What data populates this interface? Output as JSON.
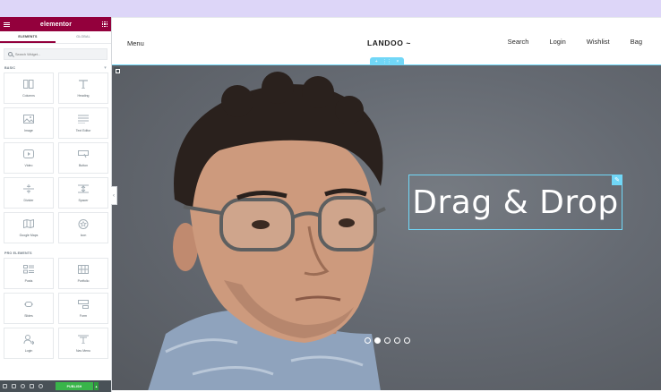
{
  "panel": {
    "brand": "elementor",
    "tabs": [
      {
        "label": "ELEMENTS",
        "active": true
      },
      {
        "label": "GLOBAL",
        "active": false
      }
    ],
    "search_placeholder": "Search Widget...",
    "categories": [
      {
        "title": "BASIC",
        "widgets": [
          {
            "label": "Columns",
            "icon": "columns-icon"
          },
          {
            "label": "Heading",
            "icon": "heading-icon"
          },
          {
            "label": "Image",
            "icon": "image-icon"
          },
          {
            "label": "Text Editor",
            "icon": "text-editor-icon"
          },
          {
            "label": "Video",
            "icon": "video-icon"
          },
          {
            "label": "Button",
            "icon": "button-icon"
          },
          {
            "label": "Divider",
            "icon": "divider-icon"
          },
          {
            "label": "Spacer",
            "icon": "spacer-icon"
          },
          {
            "label": "Google Maps",
            "icon": "map-icon"
          },
          {
            "label": "Icon",
            "icon": "star-icon"
          }
        ]
      },
      {
        "title": "PRO ELEMENTS",
        "widgets": [
          {
            "label": "Posts",
            "icon": "posts-icon"
          },
          {
            "label": "Portfolio",
            "icon": "portfolio-icon"
          },
          {
            "label": "Slides",
            "icon": "slides-icon"
          },
          {
            "label": "Form",
            "icon": "form-icon"
          },
          {
            "label": "Login",
            "icon": "login-icon"
          },
          {
            "label": "Nav Menu",
            "icon": "nav-menu-icon"
          }
        ]
      }
    ],
    "footer": {
      "publish_label": "PUBLISH"
    }
  },
  "site": {
    "nav_left": "Menu",
    "logo": "LANDOO ~",
    "nav_right": [
      "Search",
      "Login",
      "Wishlist",
      "Bag"
    ]
  },
  "hero": {
    "headline": "Drag & Drop",
    "slider": {
      "count": 5,
      "active_index": 1
    }
  },
  "colors": {
    "brand": "#93003c",
    "accent_selection": "#71d7f7",
    "publish": "#39b54a",
    "background": "#ddd6f8"
  }
}
